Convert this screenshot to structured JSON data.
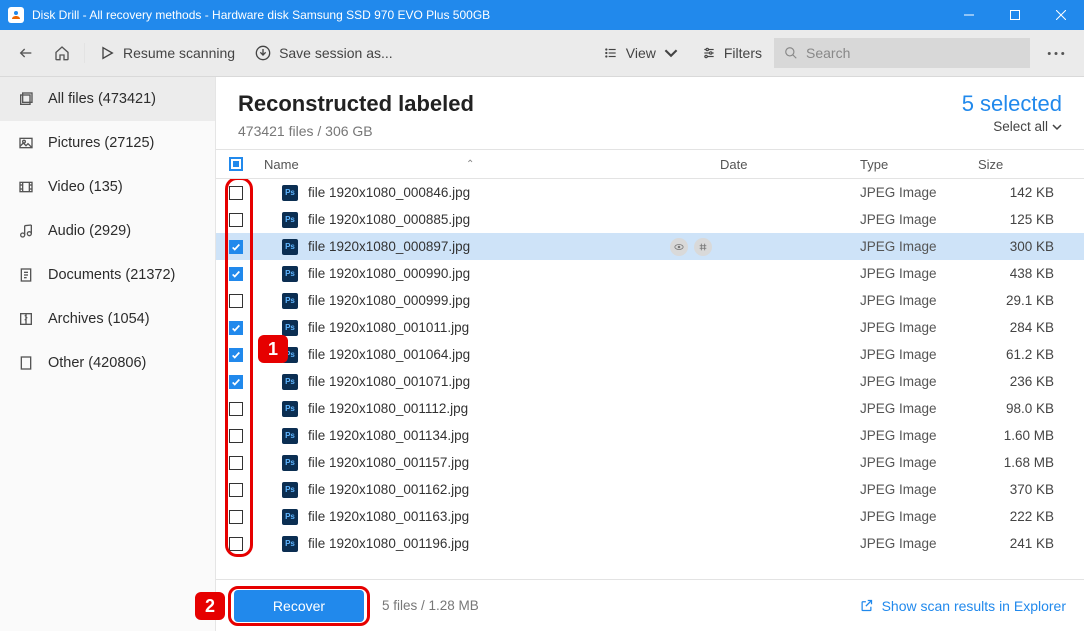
{
  "titlebar": {
    "text": "Disk Drill - All recovery methods - Hardware disk Samsung SSD 970 EVO Plus 500GB"
  },
  "toolbar": {
    "resume": "Resume scanning",
    "save": "Save session as...",
    "view": "View",
    "filters": "Filters",
    "search_placeholder": "Search"
  },
  "sidebar": {
    "items": [
      {
        "label": "All files (473421)"
      },
      {
        "label": "Pictures (27125)"
      },
      {
        "label": "Video (135)"
      },
      {
        "label": "Audio (2929)"
      },
      {
        "label": "Documents (21372)"
      },
      {
        "label": "Archives (1054)"
      },
      {
        "label": "Other (420806)"
      }
    ]
  },
  "header": {
    "title": "Reconstructed labeled",
    "subtitle": "473421 files / 306 GB",
    "selected": "5 selected",
    "select_all": "Select all"
  },
  "columns": {
    "name": "Name",
    "date": "Date",
    "type": "Type",
    "size": "Size"
  },
  "rows": [
    {
      "checked": false,
      "name": "file 1920x1080_000846.jpg",
      "type": "JPEG Image",
      "size": "142 KB",
      "sel": false
    },
    {
      "checked": false,
      "name": "file 1920x1080_000885.jpg",
      "type": "JPEG Image",
      "size": "125 KB",
      "sel": false
    },
    {
      "checked": true,
      "name": "file 1920x1080_000897.jpg",
      "type": "JPEG Image",
      "size": "300 KB",
      "sel": true
    },
    {
      "checked": true,
      "name": "file 1920x1080_000990.jpg",
      "type": "JPEG Image",
      "size": "438 KB",
      "sel": false
    },
    {
      "checked": false,
      "name": "file 1920x1080_000999.jpg",
      "type": "JPEG Image",
      "size": "29.1 KB",
      "sel": false
    },
    {
      "checked": true,
      "name": "file 1920x1080_001011.jpg",
      "type": "JPEG Image",
      "size": "284 KB",
      "sel": false
    },
    {
      "checked": true,
      "name": "file 1920x1080_001064.jpg",
      "type": "JPEG Image",
      "size": "61.2 KB",
      "sel": false
    },
    {
      "checked": true,
      "name": "file 1920x1080_001071.jpg",
      "type": "JPEG Image",
      "size": "236 KB",
      "sel": false
    },
    {
      "checked": false,
      "name": "file 1920x1080_001112.jpg",
      "type": "JPEG Image",
      "size": "98.0 KB",
      "sel": false
    },
    {
      "checked": false,
      "name": "file 1920x1080_001134.jpg",
      "type": "JPEG Image",
      "size": "1.60 MB",
      "sel": false
    },
    {
      "checked": false,
      "name": "file 1920x1080_001157.jpg",
      "type": "JPEG Image",
      "size": "1.68 MB",
      "sel": false
    },
    {
      "checked": false,
      "name": "file 1920x1080_001162.jpg",
      "type": "JPEG Image",
      "size": "370 KB",
      "sel": false
    },
    {
      "checked": false,
      "name": "file 1920x1080_001163.jpg",
      "type": "JPEG Image",
      "size": "222 KB",
      "sel": false
    },
    {
      "checked": false,
      "name": "file 1920x1080_001196.jpg",
      "type": "JPEG Image",
      "size": "241 KB",
      "sel": false
    }
  ],
  "footer": {
    "recover": "Recover",
    "info": "5 files / 1.28 MB",
    "explorer": "Show scan results in Explorer"
  },
  "annotations": {
    "badge1": "1",
    "badge2": "2"
  }
}
